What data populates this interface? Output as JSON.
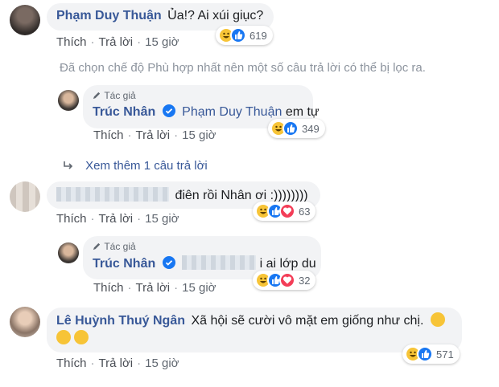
{
  "actions": {
    "like": "Thích",
    "reply": "Trả lời"
  },
  "filter_note": "Đã chọn chế độ Phù hợp nhất nên một số câu trả lời có thể bị lọc ra.",
  "author_badge": "Tác giả",
  "more_replies": "Xem thêm 1 câu trả lời",
  "colors": {
    "link": "#385898",
    "like": "#1877f2",
    "haha": "#f7c437",
    "love": "#f33e58",
    "bubble": "#f2f3f5"
  },
  "comments": [
    {
      "name": "Phạm Duy Thuận",
      "text": "Ủa!? Ai xúi giục?",
      "time": "15 giờ",
      "reaction_count": "619",
      "reactions": [
        "haha",
        "like"
      ]
    },
    {
      "name": "Trúc Nhân",
      "mention": "Phạm Duy Thuận",
      "text": "em tự",
      "time": "15 giờ",
      "reaction_count": "349",
      "reactions": [
        "haha",
        "like"
      ]
    },
    {
      "text": "điên rồi Nhân ơi :))))))))",
      "time": "15 giờ",
      "reaction_count": "63",
      "reactions": [
        "haha",
        "like",
        "love"
      ]
    },
    {
      "name": "Trúc Nhân",
      "text": "i ai lớp du",
      "time": "15 giờ",
      "reaction_count": "32",
      "reactions": [
        "haha",
        "like",
        "love"
      ]
    },
    {
      "name": "Lê Huỳnh Thuý Ngân",
      "text": "Xã hội sẽ cười vô mặt em giống như chị.",
      "time": "15 giờ",
      "reaction_count": "571",
      "reactions": [
        "haha",
        "like"
      ]
    }
  ]
}
